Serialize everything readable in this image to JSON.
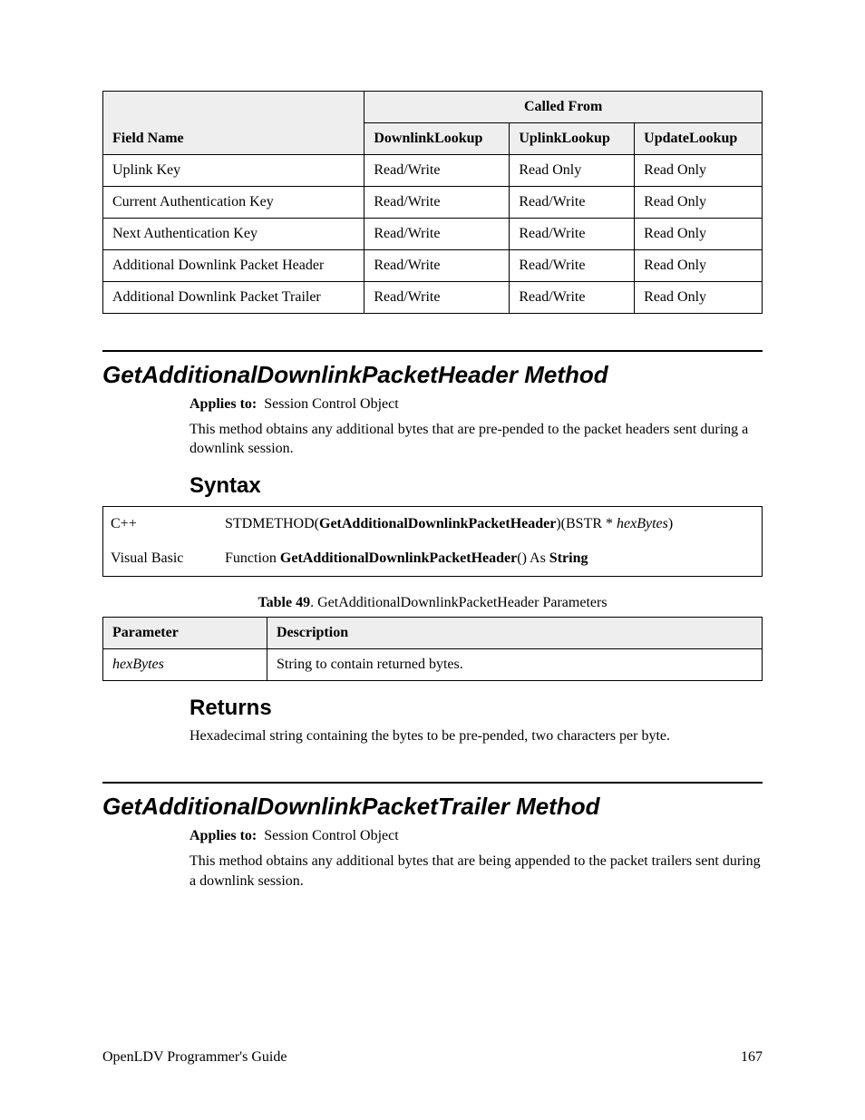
{
  "table1": {
    "header_span": "Called From",
    "col0": "Field Name",
    "cols": [
      "DownlinkLookup",
      "UplinkLookup",
      "UpdateLookup"
    ],
    "rows": [
      {
        "name": "Uplink Key",
        "cells": [
          "Read/Write",
          "Read Only",
          "Read Only"
        ]
      },
      {
        "name": "Current Authentication Key",
        "cells": [
          "Read/Write",
          "Read/Write",
          "Read Only"
        ]
      },
      {
        "name": "Next Authentication Key",
        "cells": [
          "Read/Write",
          "Read/Write",
          "Read Only"
        ]
      },
      {
        "name": "Additional Downlink Packet Header",
        "cells": [
          "Read/Write",
          "Read/Write",
          "Read Only"
        ]
      },
      {
        "name": "Additional Downlink Packet Trailer",
        "cells": [
          "Read/Write",
          "Read/Write",
          "Read Only"
        ]
      }
    ]
  },
  "method1": {
    "title": "GetAdditionalDownlinkPacketHeader Method",
    "applies_label": "Applies to:",
    "applies_value": "Session Control Object",
    "desc": "This method obtains any additional bytes that are pre-pended to the packet headers sent during a downlink session.",
    "syntax_label": "Syntax",
    "syntax": {
      "cpp_label": "C++",
      "cpp_pre": "STDMETHOD(",
      "cpp_bold": "GetAdditionalDownlinkPacketHeader",
      "cpp_mid": ")(BSTR * ",
      "cpp_ital": "hexBytes",
      "cpp_end": ")",
      "vb_label": "Visual Basic",
      "vb_pre": "Function ",
      "vb_bold": "GetAdditionalDownlinkPacketHeader",
      "vb_mid": "() As ",
      "vb_bold2": "String"
    },
    "param_caption_bold": "Table 49",
    "param_caption_rest": ". GetAdditionalDownlinkPacketHeader Parameters",
    "param_headers": [
      "Parameter",
      "Description"
    ],
    "param_row": {
      "name": "hexBytes",
      "desc": "String to contain returned bytes."
    },
    "returns_label": "Returns",
    "returns_text": "Hexadecimal string containing the bytes to be pre-pended, two characters per byte."
  },
  "method2": {
    "title": "GetAdditionalDownlinkPacketTrailer Method",
    "applies_label": "Applies to:",
    "applies_value": "Session Control Object",
    "desc": "This method obtains any additional bytes that are being appended to the packet trailers sent during a downlink session."
  },
  "footer": {
    "left": "OpenLDV Programmer's Guide",
    "right": "167"
  }
}
